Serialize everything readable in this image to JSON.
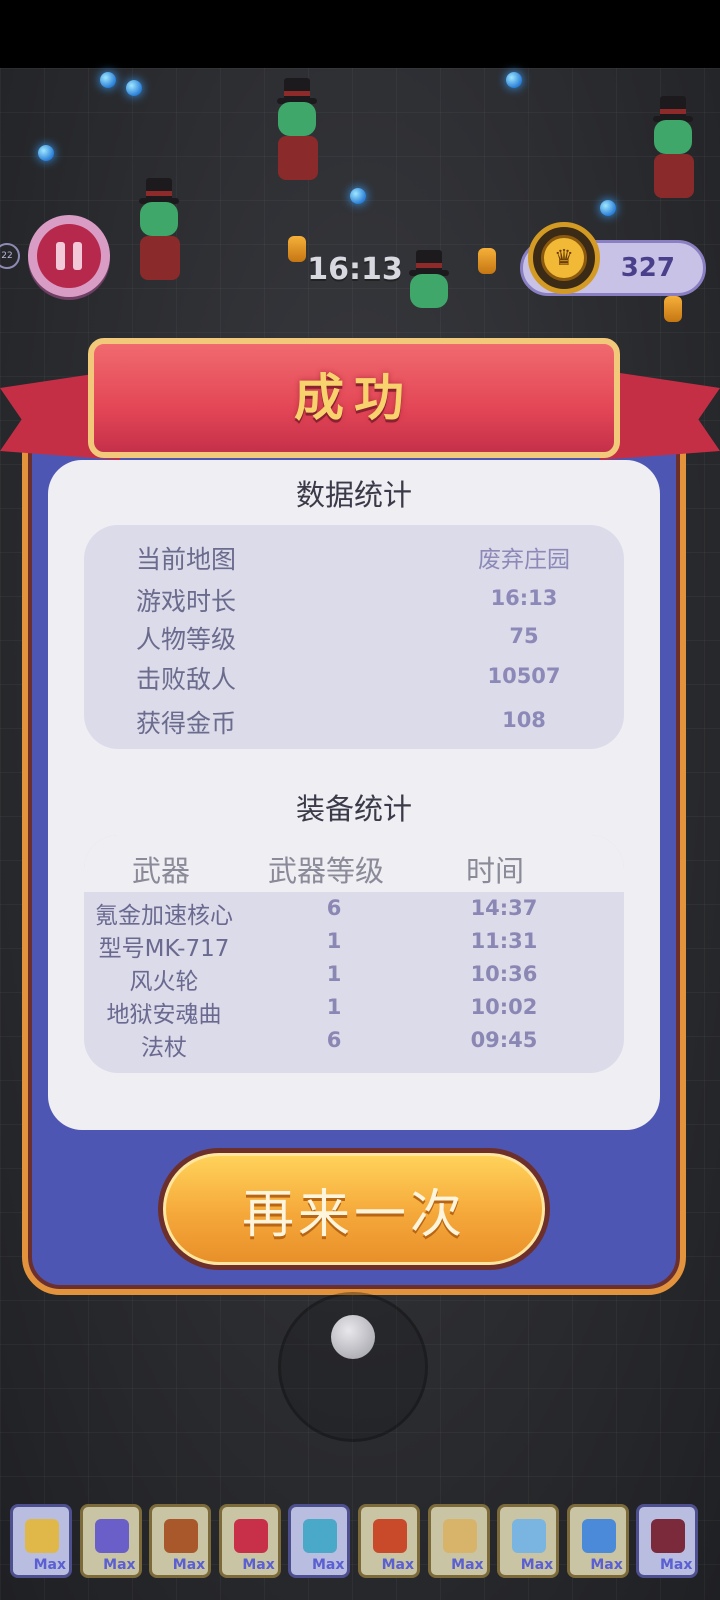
{
  "hud": {
    "timer": "16:13",
    "gold": "327",
    "mini_badge": "22"
  },
  "dialog": {
    "title": "成功",
    "stats_title": "数据统计",
    "stats": [
      {
        "label": "当前地图",
        "value": "废弃庄园"
      },
      {
        "label": "游戏时长",
        "value": "16:13"
      },
      {
        "label": "人物等级",
        "value": "75"
      },
      {
        "label": "击败敌人",
        "value": "10507"
      },
      {
        "label": "获得金币",
        "value": "108"
      }
    ],
    "equip_title": "装备统计",
    "equip_headers": {
      "weapon": "武器",
      "level": "武器等级",
      "time": "时间"
    },
    "equipment": [
      {
        "name": "氪金加速核心",
        "level": "6",
        "time": "14:37"
      },
      {
        "name": "型号MK-717",
        "level": "1",
        "time": "11:31"
      },
      {
        "name": "风火轮",
        "level": "1",
        "time": "10:36"
      },
      {
        "name": "地狱安魂曲",
        "level": "1",
        "time": "10:02"
      },
      {
        "name": "法杖",
        "level": "6",
        "time": "09:45"
      }
    ],
    "retry_label": "再来一次"
  },
  "skills": [
    {
      "icon": "diamond-icon",
      "label": "Max",
      "color": "#e0b84a"
    },
    {
      "icon": "blaster-icon",
      "label": "Max",
      "color": "#6a5fc8"
    },
    {
      "icon": "wheel-icon",
      "label": "Max",
      "color": "#a8582a"
    },
    {
      "icon": "ring-icon",
      "label": "Max",
      "color": "#c8304a"
    },
    {
      "icon": "spear-icon",
      "label": "Max",
      "color": "#4aa8c8"
    },
    {
      "icon": "torch-icon",
      "label": "Max",
      "color": "#c84a2a"
    },
    {
      "icon": "scroll-icon",
      "label": "Max",
      "color": "#d8b46a"
    },
    {
      "icon": "dagger-icon",
      "label": "Max",
      "color": "#7ab4e0"
    },
    {
      "icon": "staff-icon",
      "label": "Max",
      "color": "#4a8ad8"
    },
    {
      "icon": "wings-icon",
      "label": "Max",
      "color": "#7a2a3a"
    }
  ]
}
